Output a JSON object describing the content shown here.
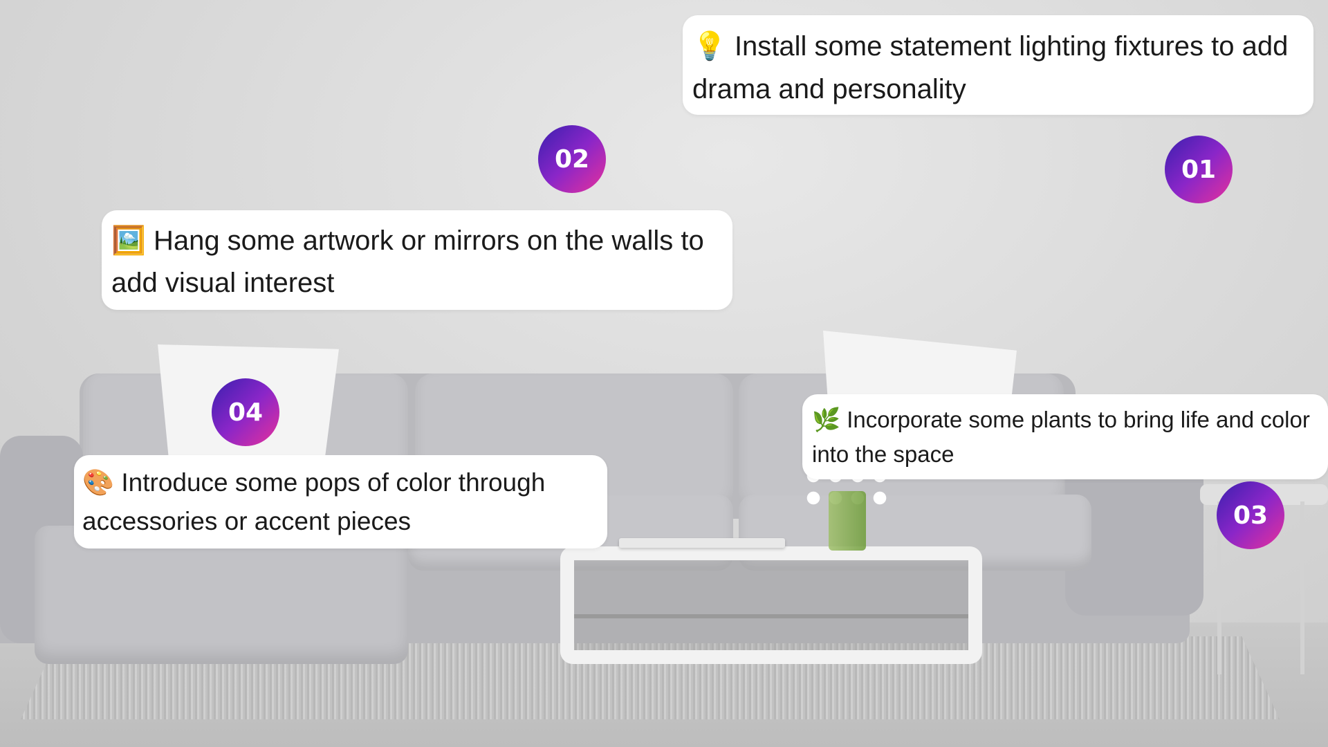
{
  "tips": [
    {
      "number": "01",
      "emoji": "💡",
      "text": "Install some statement lighting fixtures to add drama and personality",
      "emoji_icon": "lightbulb-icon"
    },
    {
      "number": "02",
      "emoji": "🖼️",
      "text": "Hang some artwork or mirrors on the walls to add visual interest",
      "emoji_icon": "framed-picture-icon"
    },
    {
      "number": "03",
      "emoji": "🌿",
      "text": "Incorporate some plants to bring life and color into the space",
      "emoji_icon": "herb-icon"
    },
    {
      "number": "04",
      "emoji": "🎨",
      "text": "Introduce some pops of color through accessories or accent pieces",
      "emoji_icon": "palette-icon"
    }
  ],
  "colors": {
    "badge_gradient": [
      "#3a1fae",
      "#8a26c8",
      "#e7319b"
    ],
    "card_background": "#ffffff"
  }
}
